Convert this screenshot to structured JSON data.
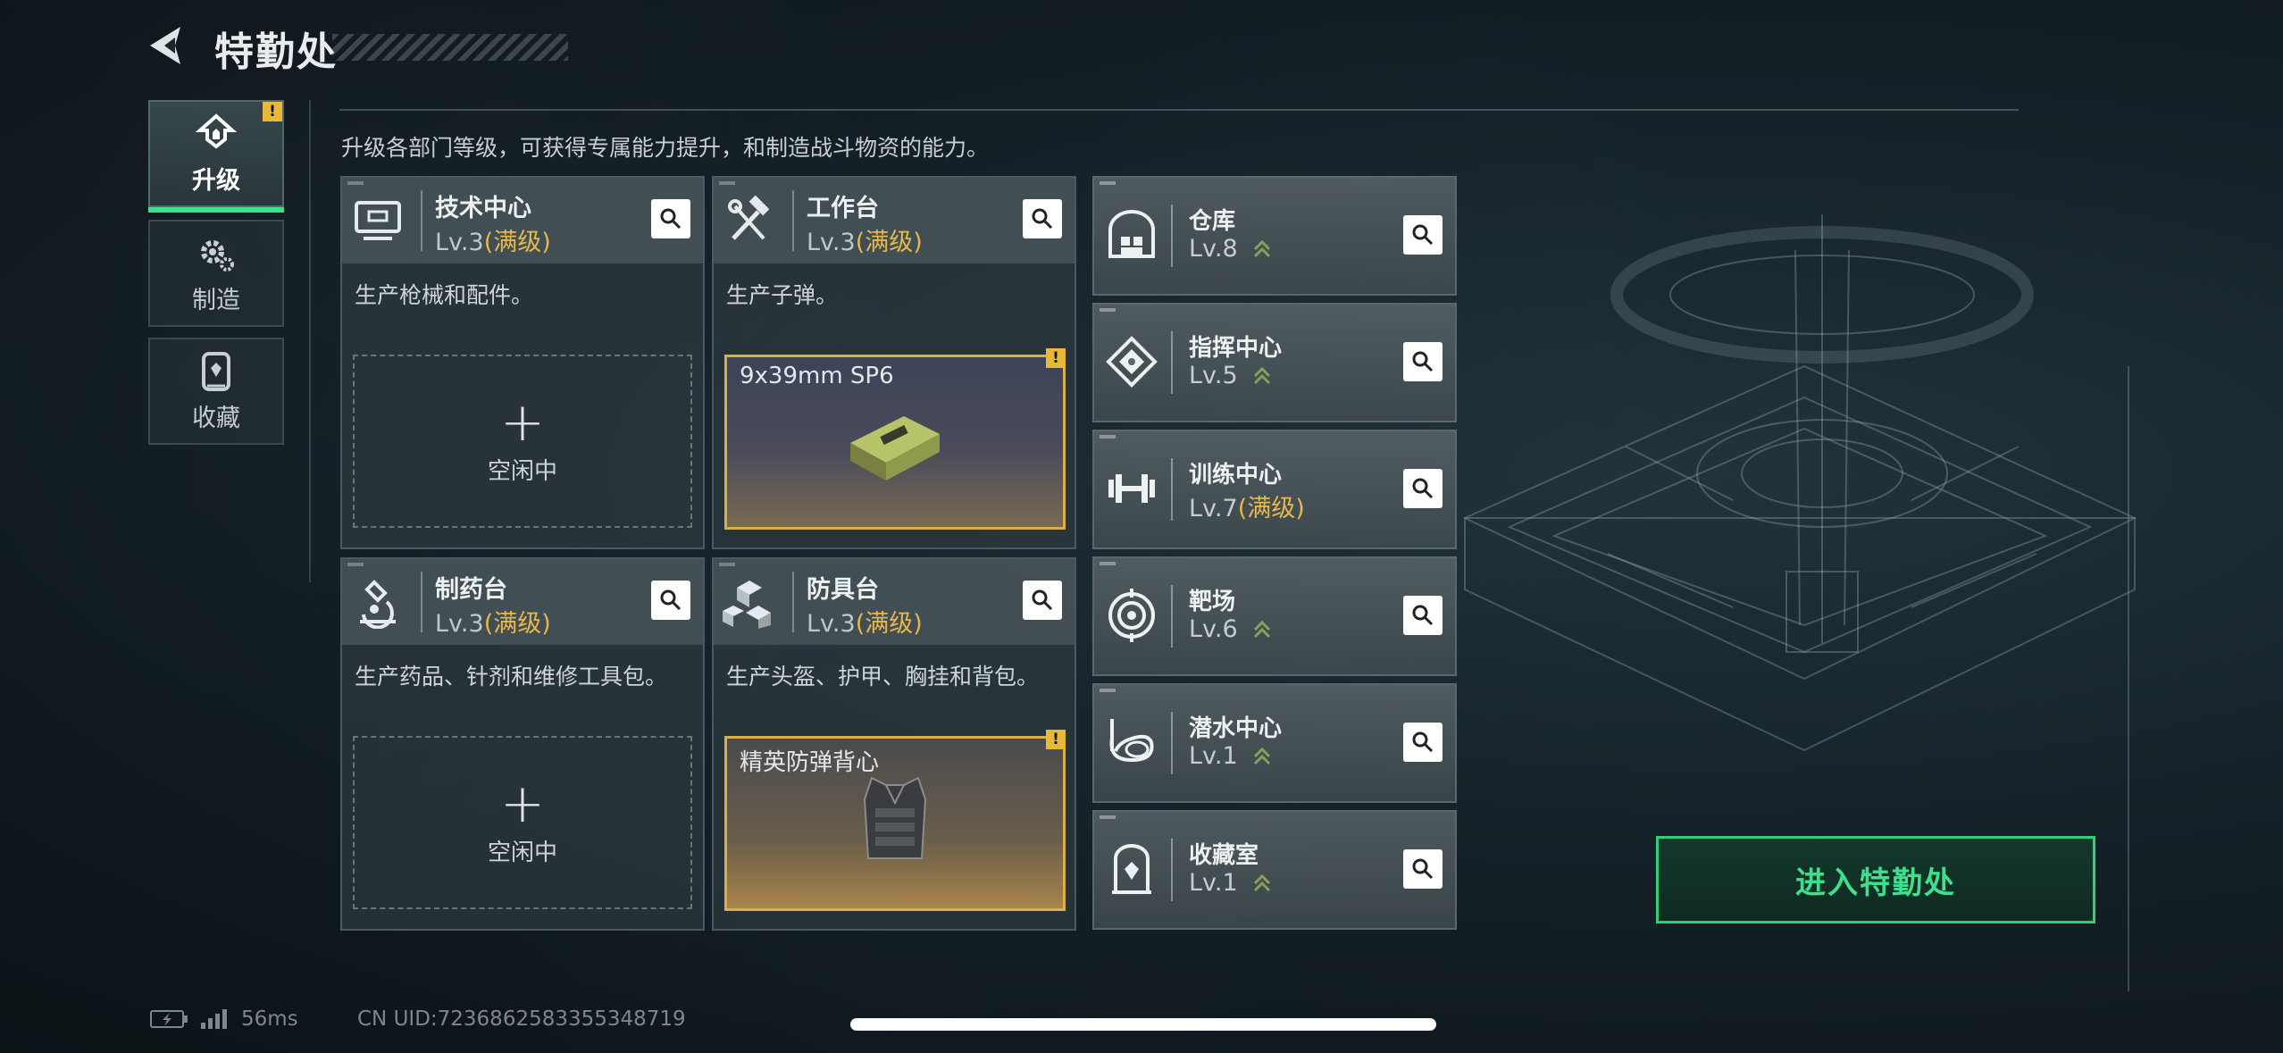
{
  "header": {
    "title": "特勤处"
  },
  "nav": [
    {
      "label": "升级",
      "active": true,
      "warning": "!"
    },
    {
      "label": "制造",
      "active": false
    },
    {
      "label": "收藏",
      "active": false
    }
  ],
  "description": "升级各部门等级，可获得专属能力提升，和制造战斗物资的能力。",
  "cards": [
    {
      "name": "技术中心",
      "level": "Lv.3",
      "max": "(满级)",
      "desc": "生产枪械和配件。",
      "slot": {
        "type": "idle",
        "plus": "+",
        "label": "空闲中"
      }
    },
    {
      "name": "工作台",
      "level": "Lv.3",
      "max": "(满级)",
      "desc": "生产子弹。",
      "slot": {
        "type": "product",
        "name": "9x39mm SP6",
        "warning": "!"
      }
    },
    {
      "name": "制药台",
      "level": "Lv.3",
      "max": "(满级)",
      "desc": "生产药品、针剂和维修工具包。",
      "slot": {
        "type": "idle",
        "plus": "+",
        "label": "空闲中"
      }
    },
    {
      "name": "防具台",
      "level": "Lv.3",
      "max": "(满级)",
      "desc": "生产头盔、护甲、胸挂和背包。",
      "slot": {
        "type": "product",
        "name": "精英防弹背心",
        "warning": "!"
      }
    }
  ],
  "facilities": [
    {
      "name": "仓库",
      "level": "Lv.8",
      "max": ""
    },
    {
      "name": "指挥中心",
      "level": "Lv.5",
      "max": ""
    },
    {
      "name": "训练中心",
      "level": "Lv.7",
      "max": "(满级)"
    },
    {
      "name": "靶场",
      "level": "Lv.6",
      "max": ""
    },
    {
      "name": "潜水中心",
      "level": "Lv.1",
      "max": ""
    },
    {
      "name": "收藏室",
      "level": "Lv.1",
      "max": ""
    }
  ],
  "enter_button": "进入特勤处",
  "status": {
    "ping": "56ms",
    "uid": "CN UID:7236862583355348719"
  },
  "colors": {
    "accent_green": "#3fe08b",
    "max_gold": "#e6b84a",
    "warning": "#e8b83a"
  }
}
